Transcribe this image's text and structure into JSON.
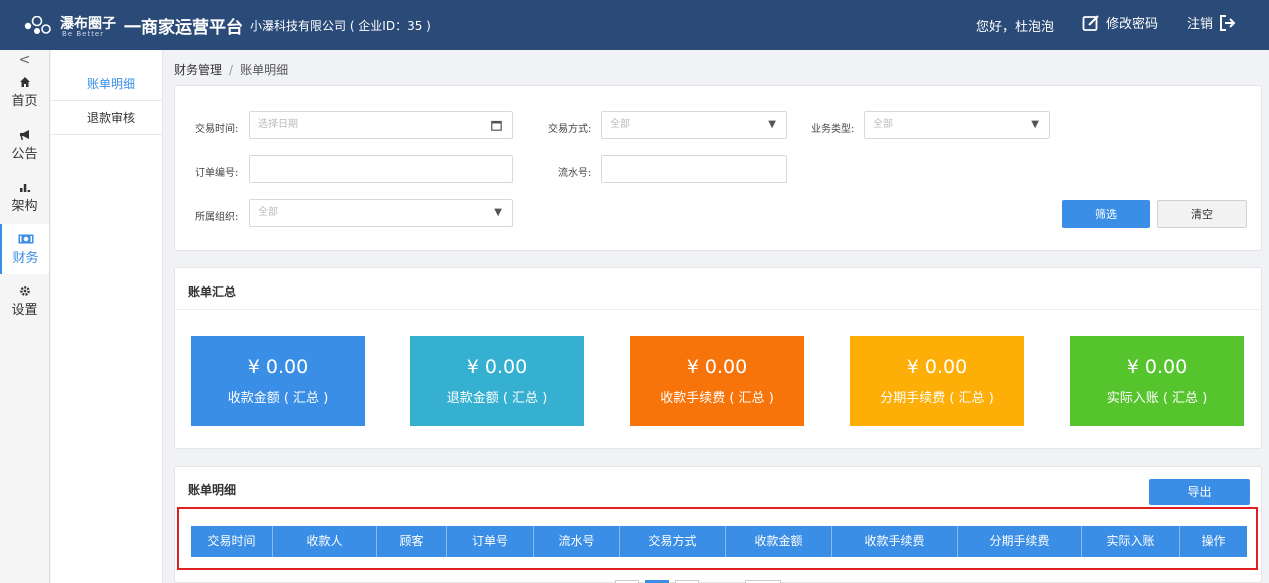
{
  "header": {
    "logo_cn": "瀑布圈子",
    "logo_en": "Be Better",
    "platform": "一商家运营平台",
    "company": "小瀑科技有限公司 ( 企业ID：35 )",
    "greeting": "您好，杜泡泡",
    "change_password": "修改密码",
    "logout": "注销"
  },
  "sidebar": {
    "collapse": "<",
    "items": [
      {
        "label": "首页",
        "icon": "home-icon"
      },
      {
        "label": "公告",
        "icon": "megaphone-icon"
      },
      {
        "label": "架构",
        "icon": "bar-chart-icon"
      },
      {
        "label": "财务",
        "icon": "money-icon"
      },
      {
        "label": "设置",
        "icon": "gear-icon"
      }
    ],
    "active_index": 3
  },
  "submenu": {
    "items": [
      "账单明细",
      "退款审核"
    ],
    "active_index": 0
  },
  "breadcrumb": {
    "parent": "财务管理",
    "separator": "/",
    "current": "账单明细"
  },
  "filter": {
    "trade_time": {
      "label": "交易时间:",
      "placeholder": "选择日期"
    },
    "trade_method": {
      "label": "交易方式:",
      "value": "全部"
    },
    "business_type": {
      "label": "业务类型:",
      "value": "全部"
    },
    "order_no": {
      "label": "订单编号:",
      "value": ""
    },
    "serial_no": {
      "label": "流水号:",
      "value": ""
    },
    "org": {
      "label": "所属组织:",
      "value": "全部"
    },
    "filter_button": "筛选",
    "clear_button": "清空"
  },
  "summary": {
    "title": "账单汇总",
    "cards": [
      {
        "amount": "¥ 0.00",
        "label": "收款金额 ( 汇总 )",
        "color": "#3a8ee6"
      },
      {
        "amount": "¥ 0.00",
        "label": "退款金额 ( 汇总 )",
        "color": "#35b0d1"
      },
      {
        "amount": "¥ 0.00",
        "label": "收款手续费 ( 汇总 )",
        "color": "#f7740b"
      },
      {
        "amount": "¥ 0.00",
        "label": "分期手续费 ( 汇总 )",
        "color": "#fdae07"
      },
      {
        "amount": "¥ 0.00",
        "label": "实际入账 ( 汇总 )",
        "color": "#56c42d"
      }
    ]
  },
  "detail": {
    "title": "账单明细",
    "export_button": "导出",
    "columns": [
      "交易时间",
      "收款人",
      "顾客",
      "订单号",
      "流水号",
      "交易方式",
      "收款金额",
      "收款手续费",
      "分期手续费",
      "实际入账",
      "操作"
    ]
  },
  "colors": {
    "header_bg": "#2a4a77",
    "primary": "#3a8ee6",
    "highlight_border": "#e02020"
  }
}
